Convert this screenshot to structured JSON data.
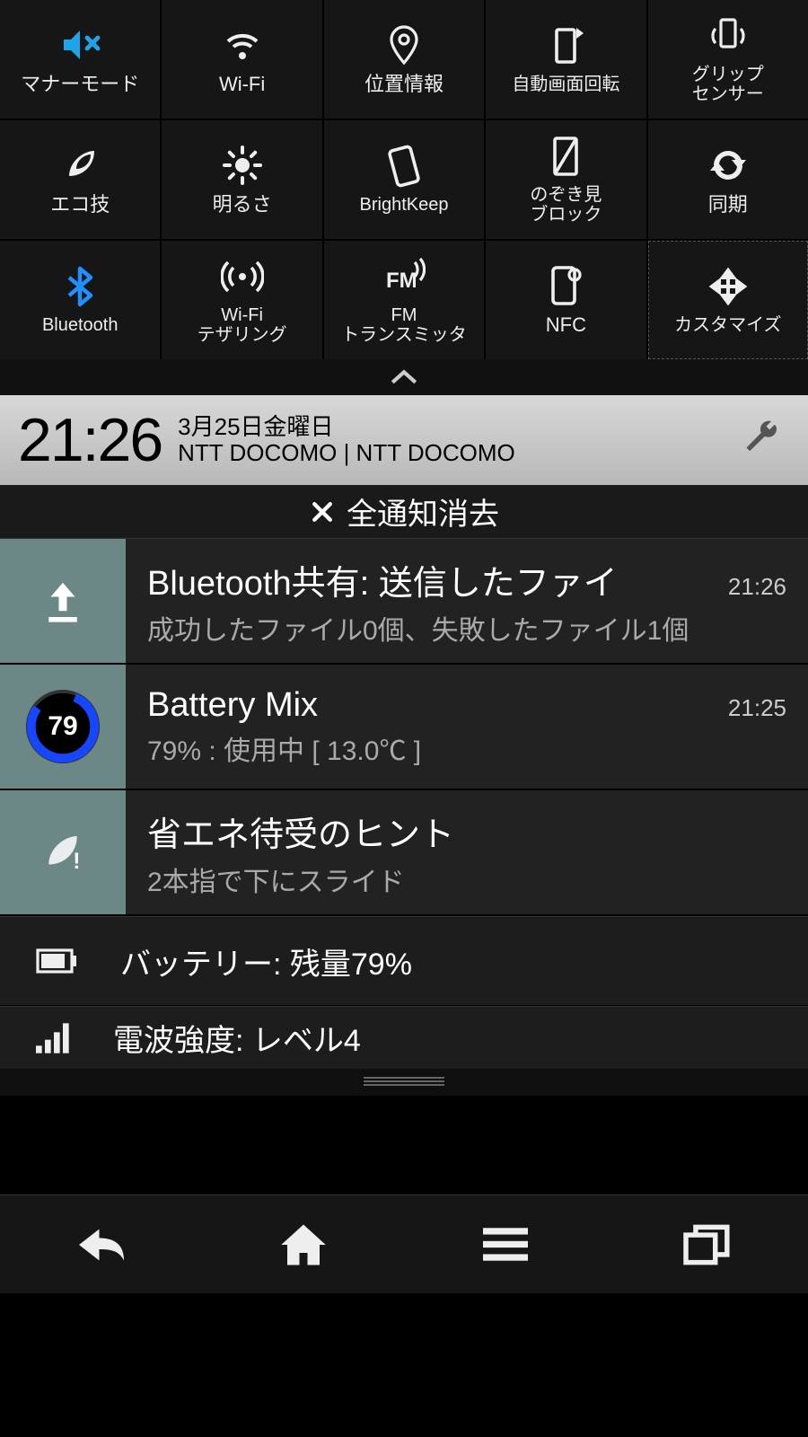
{
  "qs": {
    "tiles": [
      {
        "label": "マナーモード",
        "icon": "mute",
        "active": true
      },
      {
        "label": "Wi-Fi",
        "icon": "wifi"
      },
      {
        "label": "位置情報",
        "icon": "location"
      },
      {
        "label": "自動画面回転",
        "icon": "rotate"
      },
      {
        "label": "グリップ\nセンサー",
        "icon": "grip"
      },
      {
        "label": "エコ技",
        "icon": "eco"
      },
      {
        "label": "明るさ",
        "icon": "brightness"
      },
      {
        "label": "BrightKeep",
        "icon": "brightkeep"
      },
      {
        "label": "のぞき見\nブロック",
        "icon": "peek"
      },
      {
        "label": "同期",
        "icon": "sync"
      },
      {
        "label": "Bluetooth",
        "icon": "bluetooth",
        "active": true
      },
      {
        "label": "Wi-Fi\nテザリング",
        "icon": "tether"
      },
      {
        "label": "FM\nトランスミッタ",
        "icon": "fm"
      },
      {
        "label": "NFC",
        "icon": "nfc"
      },
      {
        "label": "カスタマイズ",
        "icon": "customize"
      }
    ]
  },
  "header": {
    "time": "21:26",
    "date": "3月25日金曜日",
    "carrier": "NTT DOCOMO | NTT DOCOMO"
  },
  "clear_all_label": "全通知消去",
  "notifications": [
    {
      "icon": "upload",
      "title": "Bluetooth共有: 送信したファイ",
      "time": "21:26",
      "sub": "成功したファイル0個、失敗したファイル1個"
    },
    {
      "icon": "battery-mix",
      "title": "Battery Mix",
      "time": "21:25",
      "sub": "79% : 使用中 [ 13.0℃ ]",
      "badge": "79"
    },
    {
      "icon": "eco-hint",
      "title": "省エネ待受のヒント",
      "time": "",
      "sub": "2本指で下にスライド"
    }
  ],
  "status_rows": [
    {
      "icon": "battery",
      "text": "バッテリー: 残量79%"
    },
    {
      "icon": "signal",
      "text": "電波強度: レベル4"
    }
  ],
  "colors": {
    "active": "#1ea4e8",
    "bt_active": "#1e90ff",
    "bmix_ring": "#1746ff"
  }
}
